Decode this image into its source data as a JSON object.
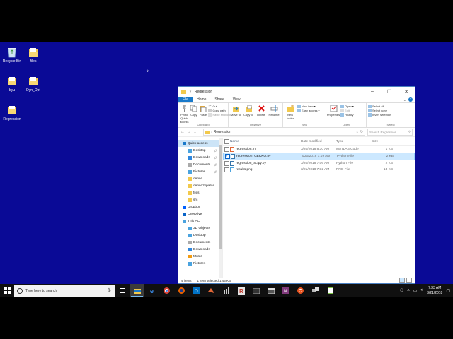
{
  "desktop": {
    "icons": [
      {
        "label": "Recycle Bin",
        "icon": "recycle-bin-icon"
      },
      {
        "label": "files",
        "icon": "folder-icon"
      },
      {
        "label": "byu",
        "icon": "folder-icon"
      },
      {
        "label": "Dyn_Opt",
        "icon": "folder-icon"
      },
      {
        "label": "Regression",
        "icon": "folder-icon"
      }
    ]
  },
  "explorer": {
    "title": "Regression",
    "tabs": [
      "File",
      "Home",
      "Share",
      "View"
    ],
    "ribbon": {
      "clipboard": {
        "label": "Clipboard",
        "pin": "Pin to Quick access",
        "copy": "Copy",
        "paste": "Paste",
        "cut": "Cut",
        "copy_path": "Copy path",
        "paste_shortcut": "Paste shortcut"
      },
      "organize": {
        "label": "Organize",
        "move_to": "Move to",
        "copy_to": "Copy to",
        "delete": "Delete",
        "rename": "Rename"
      },
      "new": {
        "label": "New",
        "new_folder": "New folder",
        "new_item": "New item",
        "easy_access": "Easy access"
      },
      "open": {
        "label": "Open",
        "properties": "Properties",
        "open": "Open",
        "edit": "Edit",
        "history": "History"
      },
      "select": {
        "label": "Select",
        "select_all": "Select all",
        "select_none": "Select none",
        "invert": "Invert selection"
      }
    },
    "address": {
      "path": "Regression",
      "search_placeholder": "Search Regression"
    },
    "nav": [
      {
        "label": "Quick access",
        "icon": "star-icon",
        "selected": true
      },
      {
        "label": "Desktop",
        "icon": "desktop-icon",
        "pinned": true
      },
      {
        "label": "Downloads",
        "icon": "download-icon",
        "pinned": true
      },
      {
        "label": "Documents",
        "icon": "documents-icon",
        "pinned": true
      },
      {
        "label": "Pictures",
        "icon": "pictures-icon",
        "pinned": true
      },
      {
        "label": "dense",
        "icon": "folder-icon"
      },
      {
        "label": "dense2sparse",
        "icon": "folder-icon"
      },
      {
        "label": "files",
        "icon": "folder-icon"
      },
      {
        "label": "src",
        "icon": "folder-icon"
      },
      {
        "label": "Dropbox",
        "icon": "dropbox-icon"
      },
      {
        "label": "OneDrive",
        "icon": "onedrive-icon"
      },
      {
        "label": "This PC",
        "icon": "pc-icon"
      },
      {
        "label": "3D Objects",
        "icon": "3d-objects-icon"
      },
      {
        "label": "Desktop",
        "icon": "desktop-icon"
      },
      {
        "label": "Documents",
        "icon": "documents-icon"
      },
      {
        "label": "Downloads",
        "icon": "download-icon"
      },
      {
        "label": "Music",
        "icon": "music-icon"
      },
      {
        "label": "Pictures",
        "icon": "pictures-icon"
      }
    ],
    "columns": {
      "name": "Name",
      "date": "Date modified",
      "type": "Type",
      "size": "Size"
    },
    "files": [
      {
        "name": "regression.m",
        "date": "3/20/2018 8:30 AM",
        "type": "MATLAB Code",
        "size": "1 KB",
        "icon": "matlab-file-icon",
        "selected": false
      },
      {
        "name": "regression_GEKKO.py",
        "date": "3/20/2018 7:19 AM",
        "type": "Python File",
        "size": "2 KB",
        "icon": "python-file-icon",
        "selected": true
      },
      {
        "name": "regression_Scipy.py",
        "date": "3/20/2018 7:06 AM",
        "type": "Python File",
        "size": "2 KB",
        "icon": "python-file-icon",
        "selected": false
      },
      {
        "name": "results.png",
        "date": "3/21/2018 7:32 AM",
        "type": "PNG File",
        "size": "13 KB",
        "icon": "image-file-icon",
        "selected": false
      }
    ],
    "status": {
      "items": "4 items",
      "selected": "1 item selected 1.45 KB"
    }
  },
  "taskbar": {
    "search_placeholder": "Type here to search",
    "time": "7:33 AM",
    "date": "3/21/2018"
  }
}
